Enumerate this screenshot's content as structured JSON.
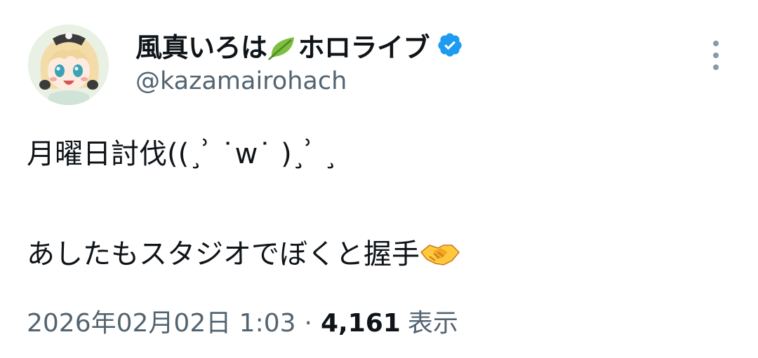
{
  "author": {
    "display_name": "風真いろは",
    "display_name_suffix": "ホロライブ",
    "leaf_emoji": "leaf-emoji",
    "handle": "@kazamairohach",
    "verified": true
  },
  "tweet": {
    "line1": "月曜日討伐((¸ ͗ ˙ᴡ˙ )¸ ͗ ¸",
    "line2": "あしたもスタジオでぼくと握手",
    "handshake_emoji": "handshake-emoji"
  },
  "meta": {
    "timestamp": "2026年02月02日 1:03",
    "separator": "·",
    "views_count": "4,161",
    "views_label": "表示"
  },
  "colors": {
    "verified_blue": "#1d9bf0",
    "secondary_text": "#536471",
    "primary_text": "#0f1419"
  }
}
